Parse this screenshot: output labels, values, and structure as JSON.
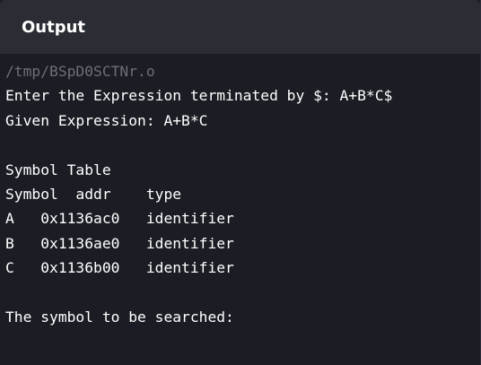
{
  "header": {
    "title": "Output"
  },
  "console": {
    "path_line": "/tmp/BSpD0SCTNr.o",
    "lines": [
      "Enter the Expression terminated by $: A+B*C$",
      "Given Expression: A+B*C",
      "",
      "Symbol Table",
      "Symbol  addr    type",
      "A   0x1136ac0   identifier",
      "B   0x1136ae0   identifier",
      "C   0x1136b00   identifier",
      "",
      "The symbol to be searched:"
    ]
  },
  "colors": {
    "background": "#1b1d24",
    "header_background": "#2a2d34",
    "text": "#ffffff",
    "muted_text": "#6c6f78"
  }
}
